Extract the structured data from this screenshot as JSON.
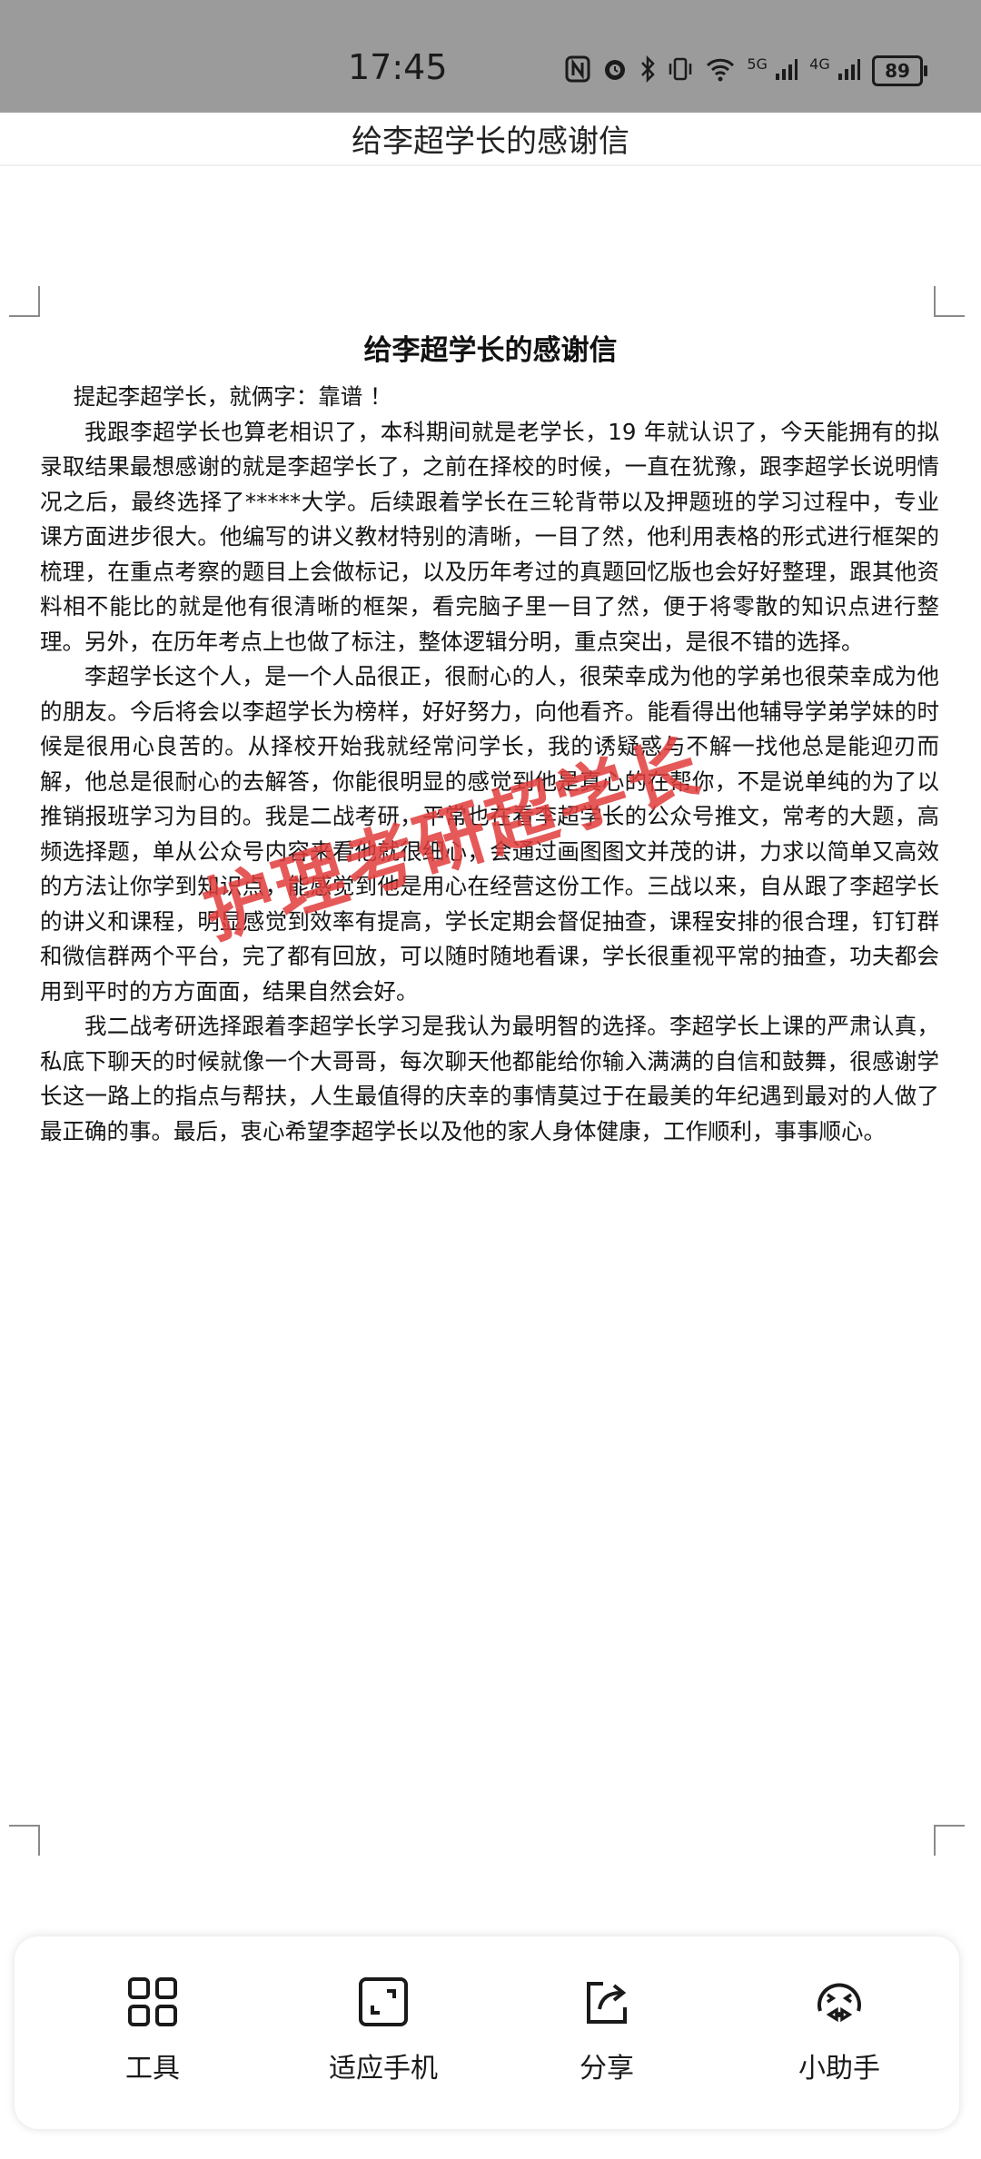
{
  "status_bar": {
    "time": "17:45",
    "network_labels": [
      "5G",
      "4G"
    ],
    "battery_level": "89",
    "icons": [
      "nfc-icon",
      "alarm-icon",
      "bluetooth-icon",
      "vibrate-icon",
      "wifi-icon",
      "signal-icon",
      "signal-icon",
      "battery-icon"
    ]
  },
  "header": {
    "title": "给李超学长的感谢信"
  },
  "document": {
    "title": "给李超学长的感谢信",
    "greeting": "提起李超学长，就俩字：靠谱 ！",
    "paragraphs": [
      "我跟李超学长也算老相识了，本科期间就是老学长，19 年就认识了，今天能拥有的拟录取结果最想感谢的就是李超学长了，之前在择校的时候，一直在犹豫，跟李超学长说明情况之后，最终选择了*****大学。后续跟着学长在三轮背带以及押题班的学习过程中，专业课方面进步很大。他编写的讲义教材特别的清晰，一目了然，他利用表格的形式进行框架的梳理，在重点考察的题目上会做标记，以及历年考过的真题回忆版也会好好整理，跟其他资料相不能比的就是他有很清晰的框架，看完脑子里一目了然，便于将零散的知识点进行整理。另外，在历年考点上也做了标注，整体逻辑分明，重点突出，是很不错的选择。",
      "李超学长这个人，是一个人品很正，很耐心的人，很荣幸成为他的学弟也很荣幸成为他的朋友。今后将会以李超学长为榜样，好好努力，向他看齐。能看得出他辅导学弟学妹的时候是很用心良苦的。从择校开始我就经常问学长，我的诱疑惑与不解一找他总是能迎刃而解，他总是很耐心的去解答，你能很明显的感觉到他是真心的在帮你，不是说单纯的为了以推销报班学习为目的。我是二战考研，平常也在看李超学长的公众号推文，常考的大题，高频选择题，单从公众号内容来看他就很细心，会通过画图图文并茂的讲，力求以简单又高效的方法让你学到知识点，能感觉到他是用心在经营这份工作。三战以来，自从跟了李超学长的讲义和课程，明显感觉到效率有提高，学长定期会督促抽查，课程安排的很合理，钉钉群和微信群两个平台，完了都有回放，可以随时随地看课，学长很重视平常的抽查，功夫都会用到平时的方方面面，结果自然会好。",
      "我二战考研选择跟着李超学长学习是我认为最明智的选择。李超学长上课的严肃认真，私底下聊天的时候就像一个大哥哥，每次聊天他都能给你输入满满的自信和鼓舞，很感谢学长这一路上的指点与帮扶，人生最值得的庆幸的事情莫过于在最美的年纪遇到最对的人做了最正确的事。最后，衷心希望李超学长以及他的家人身体健康，工作顺利，事事顺心。"
    ],
    "watermark": "护理考研超学长"
  },
  "toolbar": {
    "items": [
      {
        "label": "工具",
        "icon": "tools-grid-icon"
      },
      {
        "label": "适应手机",
        "icon": "fit-screen-icon"
      },
      {
        "label": "分享",
        "icon": "share-icon"
      },
      {
        "label": "小助手",
        "icon": "assistant-icon"
      }
    ]
  }
}
